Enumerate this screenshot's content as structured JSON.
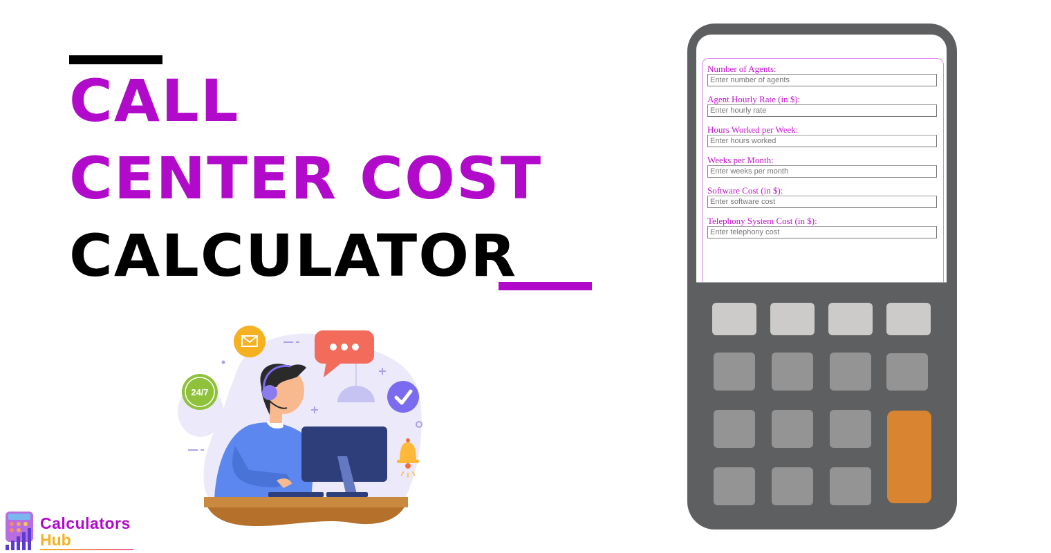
{
  "title": {
    "line1": "CALL",
    "line2": "CENTER COST",
    "line3": "CALCULATOR"
  },
  "illustration": {
    "badge_24_7": "24/7",
    "icons": [
      "envelope-icon",
      "chat-bubble-icon",
      "checkmark-icon",
      "bell-icon",
      "clock-icon",
      "headset-icon",
      "monitor-icon"
    ]
  },
  "logo": {
    "word1": "Calculators",
    "word2": "Hub"
  },
  "calculator": {
    "fields": [
      {
        "label": "Number of Agents:",
        "placeholder": "Enter number of agents",
        "value": ""
      },
      {
        "label": "Agent Hourly Rate (in $):",
        "placeholder": "Enter hourly rate",
        "value": ""
      },
      {
        "label": "Hours Worked per Week:",
        "placeholder": "Enter hours worked",
        "value": ""
      },
      {
        "label": "Weeks per Month:",
        "placeholder": "Enter weeks per month",
        "value": ""
      },
      {
        "label": "Software Cost (in $):",
        "placeholder": "Enter software cost",
        "value": ""
      },
      {
        "label": "Telephony System Cost (in $):",
        "placeholder": "Enter telephony cost",
        "value": ""
      }
    ]
  },
  "colors": {
    "accent": "#b10acb",
    "label": "#c312d1",
    "calc_body": "#5e5f61",
    "key_light": "#cccbc9",
    "key_gray": "#949494",
    "key_orange": "#d98431"
  }
}
